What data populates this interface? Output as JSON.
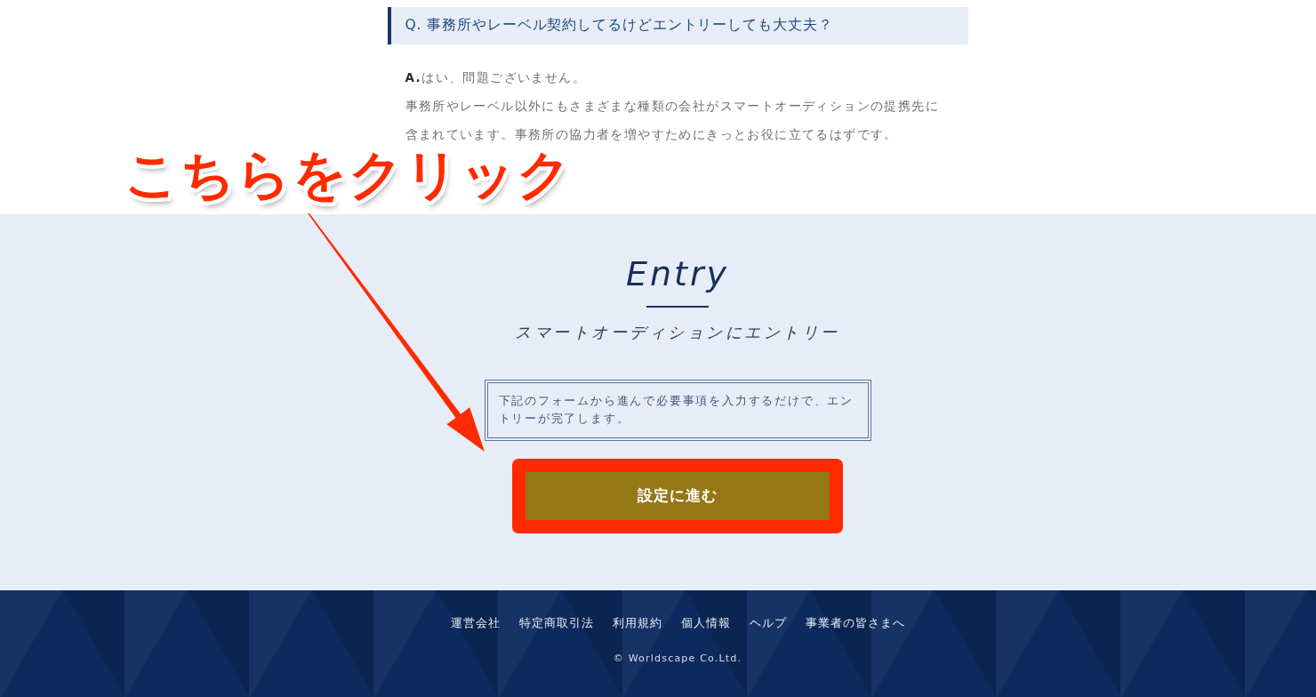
{
  "faq": {
    "question": "Q. 事務所やレーベル契約してるけどエントリーしても大丈夫？",
    "answers": [
      "**A.**はい、問題ございません。",
      "事務所やレーベル以外にもさまざまな種類の会社がスマートオーディションの提携先に含まれています。事務所の協力者を増やすためにきっとお役に立てるはずです。"
    ]
  },
  "entry": {
    "title": "Entry",
    "subtitle": "スマートオーディションにエントリー",
    "note": "下記のフォームから進んで必要事項を入力するだけで、エントリーが完了します。",
    "button": {
      "label": "設定に進む",
      "highlighted": true
    }
  },
  "footer": {
    "links": [
      "運営会社",
      "特定商取引法",
      "利用規約",
      "個人情報",
      "ヘルプ",
      "事業者の皆さまへ"
    ],
    "copyright": "© Worldscape Co.Ltd."
  },
  "annotation": {
    "text": "こちらをクリック"
  }
}
